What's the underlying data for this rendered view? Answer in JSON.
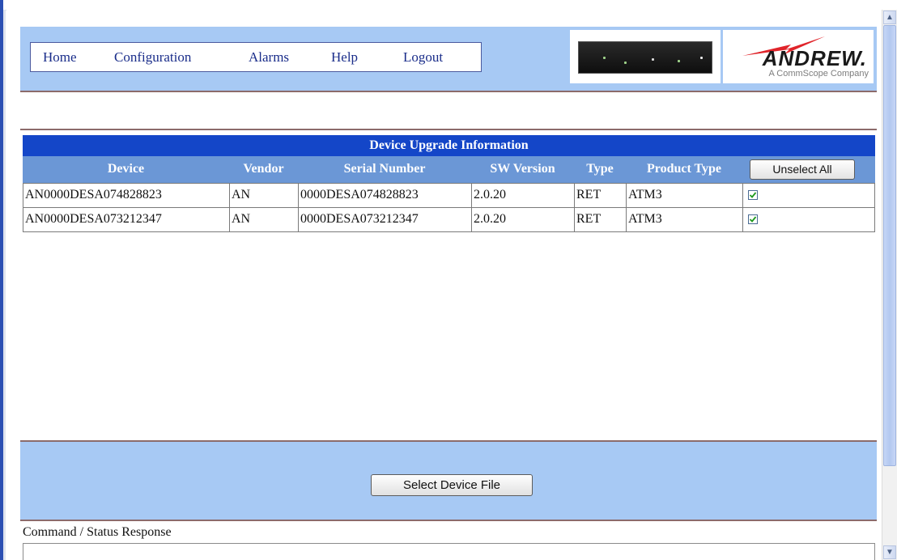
{
  "nav": {
    "items": [
      {
        "label": "Home"
      },
      {
        "label": "Configuration"
      },
      {
        "label": "Alarms"
      },
      {
        "label": "Help"
      },
      {
        "label": "Logout"
      }
    ]
  },
  "logo": {
    "brand": "ANDREW.",
    "tagline": "A CommScope Company"
  },
  "table": {
    "title": "Device Upgrade Information",
    "columns": [
      "Device",
      "Vendor",
      "Serial Number",
      "SW Version",
      "Type",
      "Product Type"
    ],
    "unselect_label": "Unselect All",
    "rows": [
      {
        "device": "AN0000DESA074828823",
        "vendor": "AN",
        "serial": "0000DESA074828823",
        "sw_version": "2.0.20",
        "type": "RET",
        "product_type": "ATM3",
        "checked": true
      },
      {
        "device": "AN0000DESA073212347",
        "vendor": "AN",
        "serial": "0000DESA073212347",
        "sw_version": "2.0.20",
        "type": "RET",
        "product_type": "ATM3",
        "checked": true
      }
    ]
  },
  "bottom": {
    "select_file_label": "Select Device File"
  },
  "status": {
    "label": "Command / Status Response",
    "value": ""
  },
  "colors": {
    "title_bar": "#1446c8",
    "header_row": "#6b97d6",
    "panel": "#a7c9f4",
    "logo_red": "#e0242a"
  }
}
